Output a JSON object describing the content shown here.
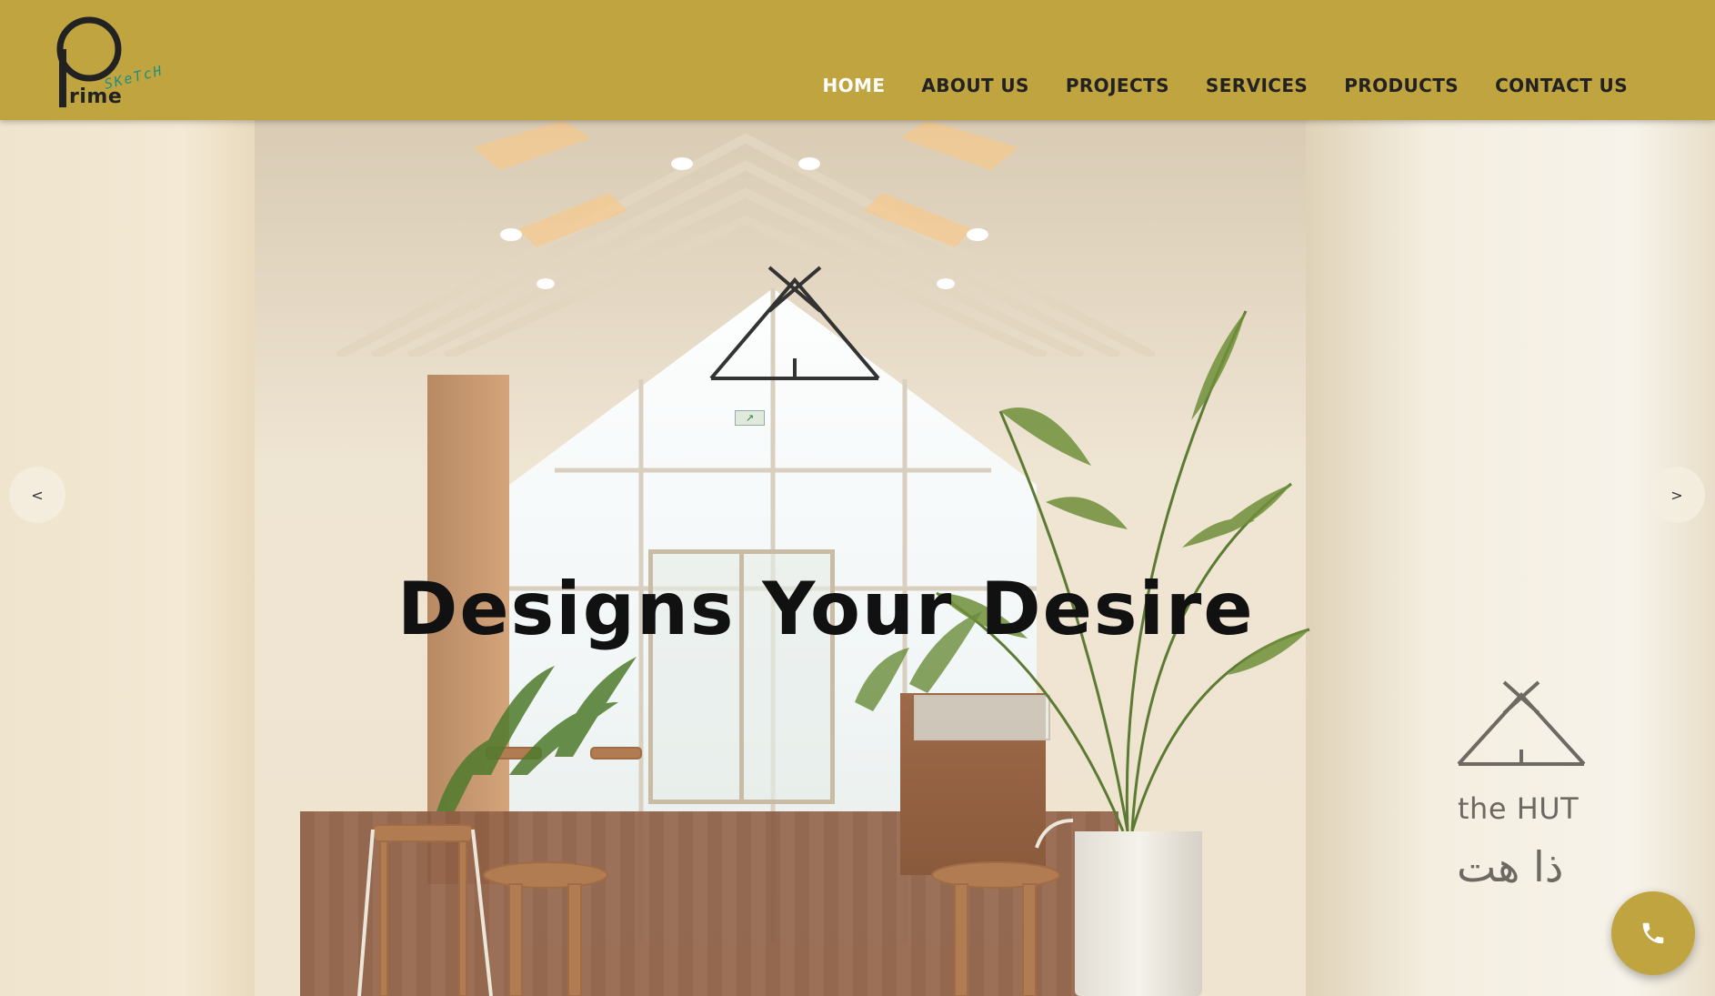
{
  "brand": {
    "logo_word": "rime",
    "logo_sketch": "SKeTcH",
    "colors": {
      "header_bg": "#c0a43f",
      "nav_text": "#222222",
      "nav_active": "#ffffff",
      "sketch_accent": "#1f8e7c"
    }
  },
  "nav": {
    "items": [
      {
        "label": "HOME",
        "active": true
      },
      {
        "label": "ABOUT US",
        "active": false
      },
      {
        "label": "PROJECTS",
        "active": false
      },
      {
        "label": "SERVICES",
        "active": false
      },
      {
        "label": "PRODUCTS",
        "active": false
      },
      {
        "label": "CONTACT US",
        "active": false
      }
    ]
  },
  "hero": {
    "headline": "Designs Your Desire",
    "prev_label": "<",
    "next_label": ">",
    "sign_name": "the HUT",
    "sign_arabic": "ذا هت"
  },
  "call_button": {
    "icon": "phone-icon"
  }
}
